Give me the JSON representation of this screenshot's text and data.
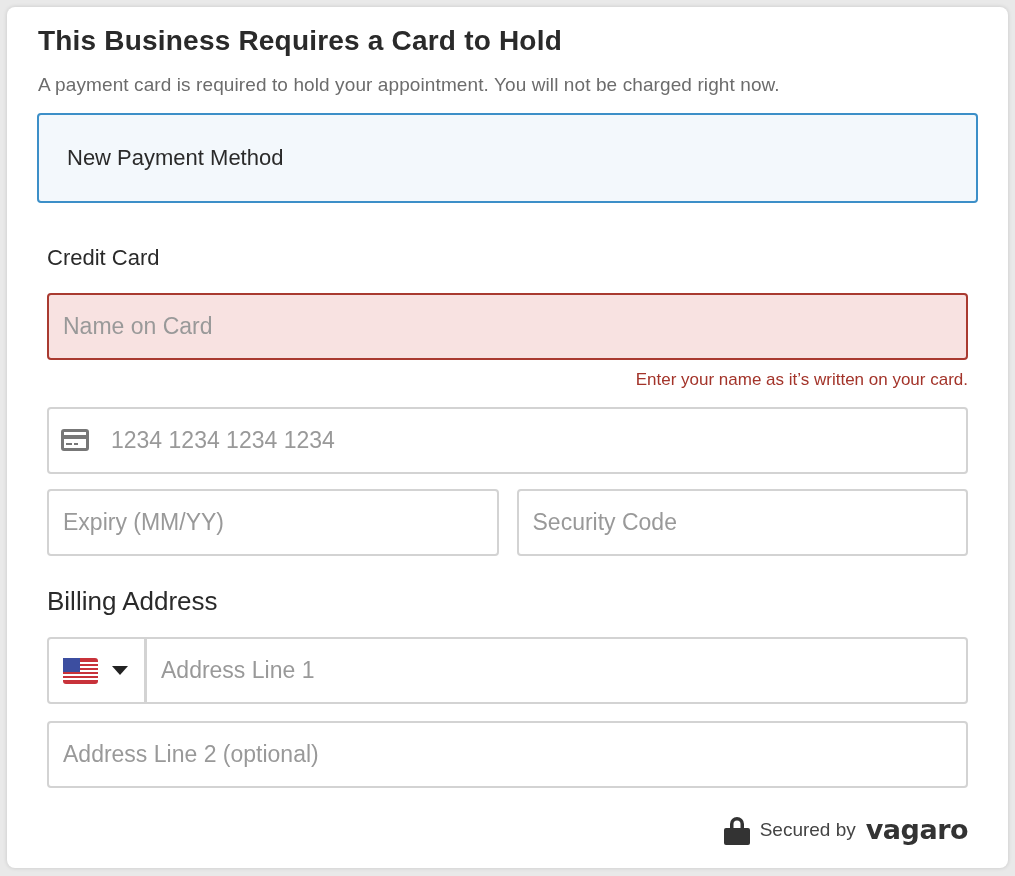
{
  "title": "This Business Requires a Card to Hold",
  "subtitle": "A payment card is required to hold your appointment. You will not be charged right now.",
  "payment_method": {
    "label": "New Payment Method",
    "selected": true
  },
  "credit_card": {
    "heading": "Credit Card",
    "name_field": {
      "placeholder": "Name on Card",
      "error": "Enter your name as it’s written on your card."
    },
    "number_field": {
      "placeholder": "1234 1234 1234 1234"
    },
    "expiry_field": {
      "placeholder": "Expiry (MM/YY)"
    },
    "security_field": {
      "placeholder": "Security Code"
    }
  },
  "billing_address": {
    "heading": "Billing Address",
    "line1_field": {
      "placeholder": "Address Line 1"
    },
    "line2_field": {
      "placeholder": "Address Line 2 (optional)"
    }
  },
  "footer": {
    "secured": "Secured by",
    "brand": "vagaro"
  }
}
